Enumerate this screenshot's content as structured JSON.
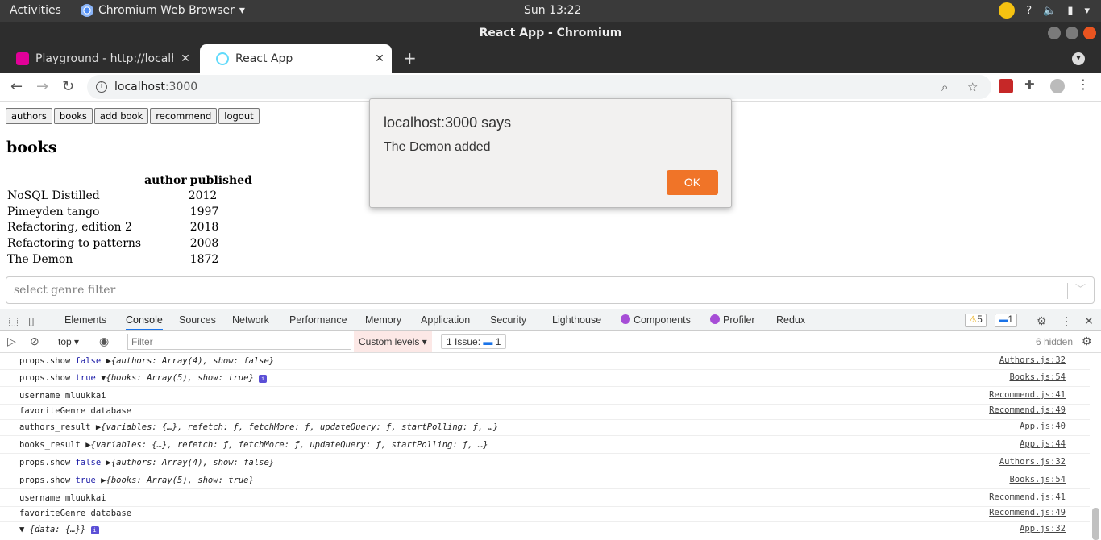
{
  "os": {
    "activities": "Activities",
    "app_name": "Chromium Web Browser",
    "clock": "Sun 13:22"
  },
  "window": {
    "title": "React App - Chromium"
  },
  "tabs": [
    {
      "label": "Playground - http://localh",
      "active": false
    },
    {
      "label": "React App",
      "active": true
    }
  ],
  "address": {
    "host": "localhost",
    "port": ":3000"
  },
  "app": {
    "nav": [
      "authors",
      "books",
      "add book",
      "recommend",
      "logout"
    ],
    "heading": "books",
    "table": {
      "headers": [
        "",
        "author",
        "published"
      ],
      "rows": [
        {
          "title": "NoSQL Distilled",
          "published": "2012"
        },
        {
          "title": "Pimeyden tango",
          "published": "1997"
        },
        {
          "title": "Refactoring, edition 2",
          "published": "2018"
        },
        {
          "title": "Refactoring to patterns",
          "published": "2008"
        },
        {
          "title": "The Demon",
          "published": "1872"
        }
      ]
    },
    "genre_placeholder": "select genre filter"
  },
  "alert": {
    "title": "localhost:3000 says",
    "message": "The Demon added",
    "ok": "OK"
  },
  "devtools": {
    "tabs": [
      "Elements",
      "Console",
      "Sources",
      "Network",
      "Performance",
      "Memory",
      "Application",
      "Security",
      "Lighthouse",
      "Components",
      "Profiler",
      "Redux"
    ],
    "warnings": "5",
    "messages": "1",
    "context": "top",
    "filter_placeholder": "Filter",
    "levels": "Custom levels",
    "issues": "1 Issue:",
    "issues_count": "1",
    "hidden": "6 hidden"
  },
  "console": [
    {
      "label": "props.show",
      "kw": "false",
      "obj": "{authors: Array(4), show: false}",
      "src": "Authors.js:32",
      "expanded": false
    },
    {
      "label": "props.show",
      "kw": "true",
      "obj": "{books: Array(5), show: true}",
      "src": "Books.js:54",
      "expanded": true
    },
    {
      "label": "username mluukkai",
      "kw": "",
      "obj": "",
      "src": "Recommend.js:41"
    },
    {
      "label": "favoriteGenre database",
      "kw": "",
      "obj": "",
      "src": "Recommend.js:49"
    },
    {
      "label": "authors_result",
      "kw": "",
      "obj": "{variables: {…}, refetch: ƒ, fetchMore: ƒ, updateQuery: ƒ, startPolling: ƒ, …}",
      "src": "App.js:40"
    },
    {
      "label": "books_result",
      "kw": "",
      "obj": "{variables: {…}, refetch: ƒ, fetchMore: ƒ, updateQuery: ƒ, startPolling: ƒ, …}",
      "src": "App.js:44"
    },
    {
      "label": "props.show",
      "kw": "false",
      "obj": "{authors: Array(4), show: false}",
      "src": "Authors.js:32"
    },
    {
      "label": "props.show",
      "kw": "true",
      "obj": "{books: Array(5), show: true}",
      "src": "Books.js:54"
    },
    {
      "label": "username mluukkai",
      "kw": "",
      "obj": "",
      "src": "Recommend.js:41"
    },
    {
      "label": "favoriteGenre database",
      "kw": "",
      "obj": "",
      "src": "Recommend.js:49"
    },
    {
      "label": "",
      "kw": "",
      "obj": "{data: {…}}",
      "src": "App.js:32"
    }
  ],
  "colors": {
    "accent": "#f07428",
    "devtools_active": "#1a73e8",
    "ubuntu_close": "#e95420"
  }
}
